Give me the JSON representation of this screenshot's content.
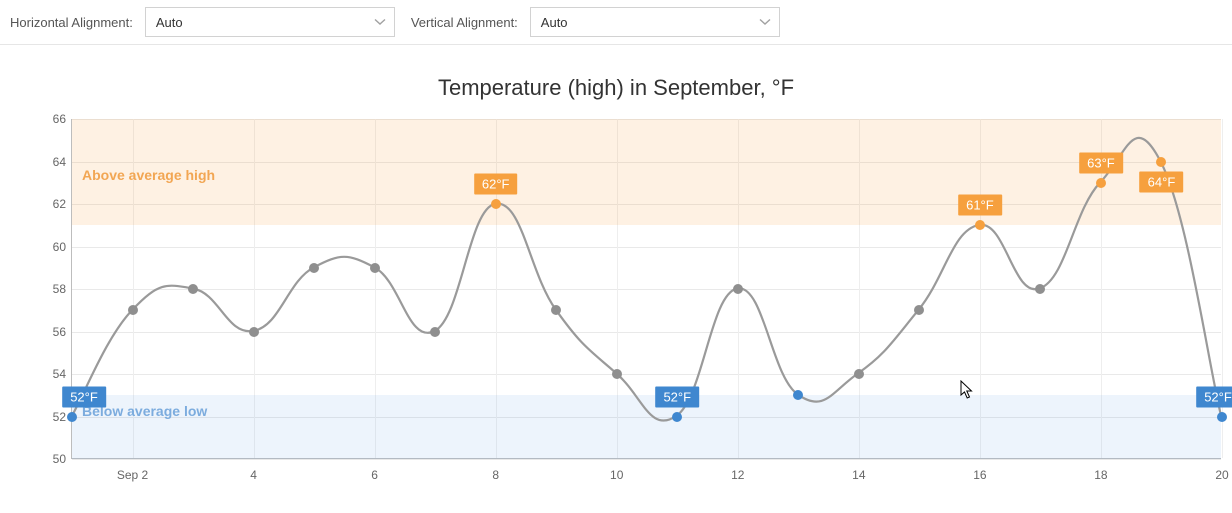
{
  "toolbar": {
    "h_label": "Horizontal Alignment:",
    "v_label": "Vertical Alignment:",
    "h_value": "Auto",
    "v_value": "Auto"
  },
  "chart_data": {
    "type": "line",
    "title": "Temperature (high) in September, °F",
    "xlabel": "",
    "ylabel": "",
    "ylim": [
      50,
      66
    ],
    "x": [
      1,
      2,
      3,
      4,
      5,
      6,
      7,
      8,
      9,
      10,
      11,
      12,
      13,
      14,
      15,
      16,
      17,
      18,
      19,
      20
    ],
    "values": [
      52,
      57,
      58,
      56,
      59,
      59,
      56,
      62,
      57,
      54,
      52,
      58,
      53,
      54,
      57,
      61,
      58,
      63,
      64,
      52
    ],
    "x_tick_labels": [
      "Sep 2",
      "4",
      "6",
      "8",
      "10",
      "12",
      "14",
      "16",
      "18",
      "20"
    ],
    "x_tick_positions": [
      2,
      4,
      6,
      8,
      10,
      12,
      14,
      16,
      18,
      20
    ],
    "y_ticks": [
      50,
      52,
      54,
      56,
      58,
      60,
      62,
      64,
      66
    ],
    "bands": {
      "high": {
        "from": 61,
        "to": 66,
        "label": "Above average high",
        "color": "#f6a03e"
      },
      "low": {
        "from": 50,
        "to": 53,
        "label": "Below average low",
        "color": "#3f87cf"
      }
    },
    "labeled_points": [
      {
        "x": 1,
        "value": 52,
        "text": "52°F",
        "style": "blue",
        "pos": "above"
      },
      {
        "x": 8,
        "value": 62,
        "text": "62°F",
        "style": "orange",
        "pos": "above"
      },
      {
        "x": 11,
        "value": 52,
        "text": "52°F",
        "style": "blue",
        "pos": "above"
      },
      {
        "x": 16,
        "value": 61,
        "text": "61°F",
        "style": "orange",
        "pos": "above"
      },
      {
        "x": 18,
        "value": 63,
        "text": "63°F",
        "style": "orange",
        "pos": "above"
      },
      {
        "x": 19,
        "value": 64,
        "text": "64°F",
        "style": "orange",
        "pos": "below"
      },
      {
        "x": 20,
        "value": 52,
        "text": "52°F",
        "style": "blue",
        "pos": "above"
      }
    ],
    "colors": {
      "line": "#9a9a9a",
      "point_default": "#8f8f8f",
      "high": "#f6a03e",
      "low": "#3f87cf"
    }
  }
}
